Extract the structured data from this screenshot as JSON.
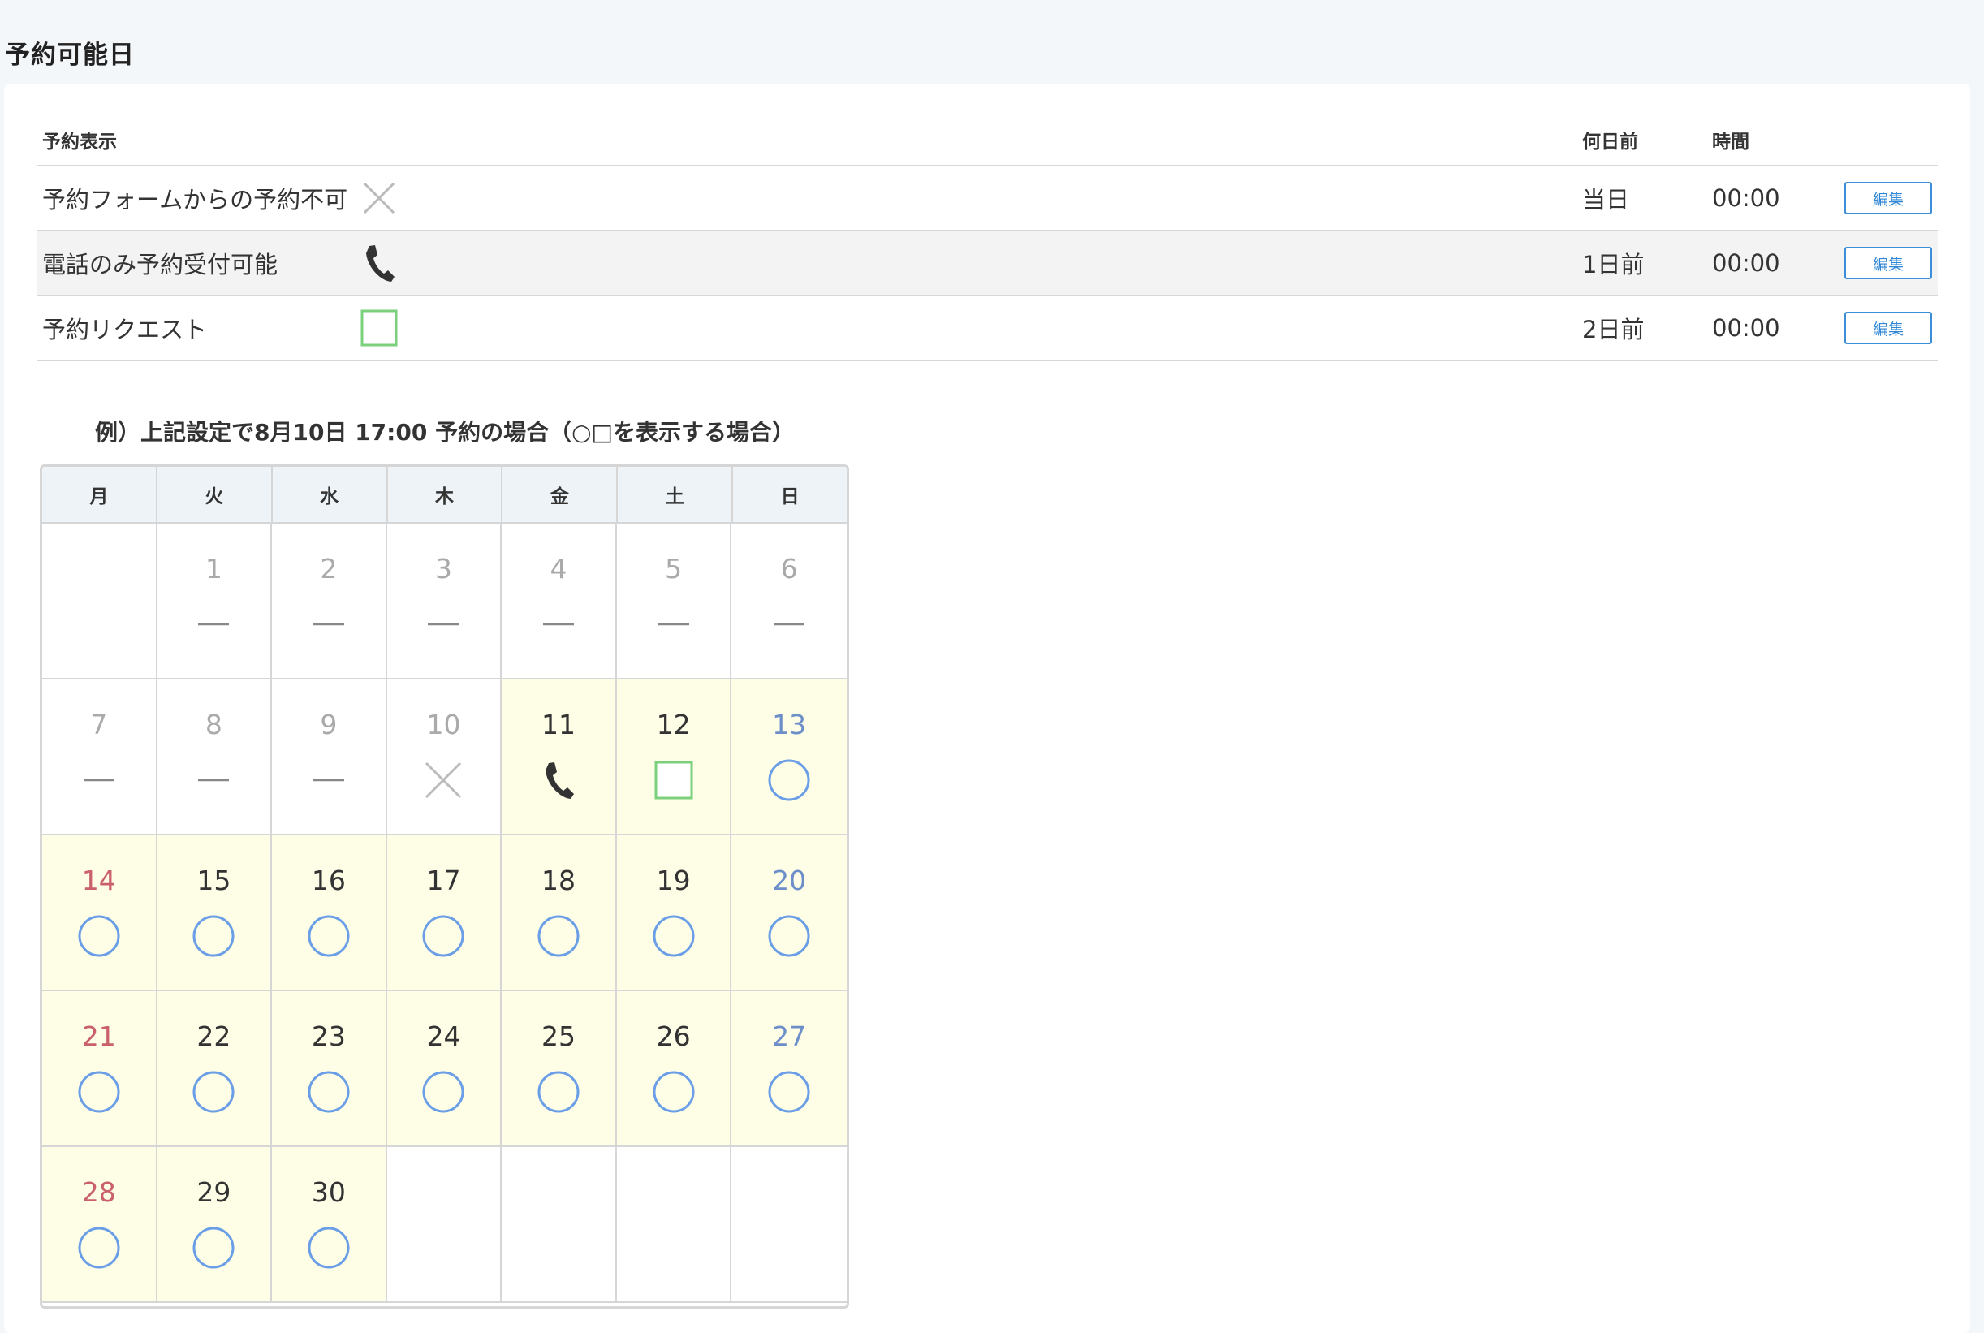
{
  "page": {
    "title": "予約可能日"
  },
  "settings": {
    "headers": {
      "display": "予約表示",
      "days_before": "何日前",
      "time": "時間"
    },
    "rows": [
      {
        "label": "予約フォームからの予約不可",
        "icon": "cross-icon",
        "days_before": "当日",
        "time": "00:00",
        "edit_label": "編集"
      },
      {
        "label": "電話のみ予約受付可能",
        "icon": "phone-icon",
        "days_before": "1日前",
        "time": "00:00",
        "edit_label": "編集"
      },
      {
        "label": "予約リクエスト",
        "icon": "square-icon",
        "days_before": "2日前",
        "time": "00:00",
        "edit_label": "編集"
      }
    ]
  },
  "example": {
    "caption": "例）上記設定で8月10日 17:00 予約の場合（○□を表示する場合）",
    "weekdays": [
      "月",
      "火",
      "水",
      "木",
      "金",
      "土",
      "日"
    ],
    "days": [
      {
        "num": "",
        "status": "empty",
        "avail": false,
        "color": "normal"
      },
      {
        "num": "1",
        "status": "past",
        "avail": false,
        "color": "past"
      },
      {
        "num": "2",
        "status": "past",
        "avail": false,
        "color": "past"
      },
      {
        "num": "3",
        "status": "past",
        "avail": false,
        "color": "past"
      },
      {
        "num": "4",
        "status": "past",
        "avail": false,
        "color": "past"
      },
      {
        "num": "5",
        "status": "past",
        "avail": false,
        "color": "past"
      },
      {
        "num": "6",
        "status": "past",
        "avail": false,
        "color": "past"
      },
      {
        "num": "7",
        "status": "past",
        "avail": false,
        "color": "past"
      },
      {
        "num": "8",
        "status": "past",
        "avail": false,
        "color": "past"
      },
      {
        "num": "9",
        "status": "past",
        "avail": false,
        "color": "past"
      },
      {
        "num": "10",
        "status": "cross",
        "avail": false,
        "color": "past"
      },
      {
        "num": "11",
        "status": "phone",
        "avail": true,
        "color": "normal"
      },
      {
        "num": "12",
        "status": "square",
        "avail": true,
        "color": "normal"
      },
      {
        "num": "13",
        "status": "circle",
        "avail": true,
        "color": "sat"
      },
      {
        "num": "14",
        "status": "circle",
        "avail": true,
        "color": "sun"
      },
      {
        "num": "15",
        "status": "circle",
        "avail": true,
        "color": "normal"
      },
      {
        "num": "16",
        "status": "circle",
        "avail": true,
        "color": "normal"
      },
      {
        "num": "17",
        "status": "circle",
        "avail": true,
        "color": "normal"
      },
      {
        "num": "18",
        "status": "circle",
        "avail": true,
        "color": "normal"
      },
      {
        "num": "19",
        "status": "circle",
        "avail": true,
        "color": "normal"
      },
      {
        "num": "20",
        "status": "circle",
        "avail": true,
        "color": "sat"
      },
      {
        "num": "21",
        "status": "circle",
        "avail": true,
        "color": "sun"
      },
      {
        "num": "22",
        "status": "circle",
        "avail": true,
        "color": "normal"
      },
      {
        "num": "23",
        "status": "circle",
        "avail": true,
        "color": "normal"
      },
      {
        "num": "24",
        "status": "circle",
        "avail": true,
        "color": "normal"
      },
      {
        "num": "25",
        "status": "circle",
        "avail": true,
        "color": "normal"
      },
      {
        "num": "26",
        "status": "circle",
        "avail": true,
        "color": "normal"
      },
      {
        "num": "27",
        "status": "circle",
        "avail": true,
        "color": "sat"
      },
      {
        "num": "28",
        "status": "circle",
        "avail": true,
        "color": "sun"
      },
      {
        "num": "29",
        "status": "circle",
        "avail": true,
        "color": "normal"
      },
      {
        "num": "30",
        "status": "circle",
        "avail": true,
        "color": "normal"
      },
      {
        "num": "",
        "status": "empty",
        "avail": false,
        "color": "normal"
      },
      {
        "num": "",
        "status": "empty",
        "avail": false,
        "color": "normal"
      },
      {
        "num": "",
        "status": "empty",
        "avail": false,
        "color": "normal"
      },
      {
        "num": "",
        "status": "empty",
        "avail": false,
        "color": "normal"
      }
    ]
  },
  "colors": {
    "accent": "#2f86d4",
    "available_bg": "#fefde6",
    "circle": "#6a9ee6",
    "square": "#7bd07b",
    "cross": "#bbbbbb",
    "dash": "#888888",
    "saturday": "#6c8fc9",
    "sunday": "#c9606a"
  }
}
